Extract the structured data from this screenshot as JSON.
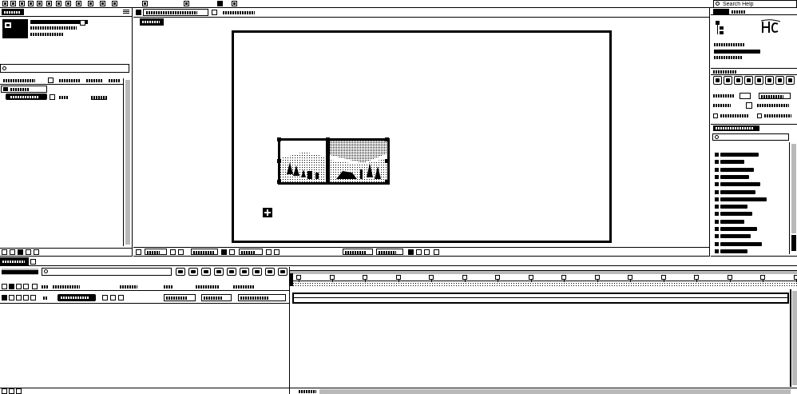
{
  "colors": {
    "ink": "#000000",
    "paper": "#ffffff"
  },
  "toolbar": {
    "tools": [
      "selection-tool-icon",
      "hand-tool-icon",
      "zoom-tool-icon",
      "rotation-tool-icon",
      "camera-tool-icon",
      "pan-behind-tool-icon",
      "rectangle-tool-icon",
      "pen-tool-icon",
      "type-tool-icon",
      "brush-tool-icon",
      "clone-stamp-tool-icon",
      "eraser-tool-icon",
      "roto-brush-tool-icon",
      "puppet-tool-icon",
      "fill-swatch-icon",
      "stroke-swatch-icon"
    ],
    "search_help": {
      "placeholder": "Search Help"
    }
  },
  "project_panel": {
    "footer_icons": [
      "interpret-footage-icon",
      "new-folder-icon",
      "new-composition-icon",
      "color-depth-icon",
      "delete-icon"
    ]
  },
  "preview_panel": {
    "buttons": [
      "first-frame-icon",
      "previous-frame-icon",
      "play-icon",
      "next-frame-icon",
      "last-frame-icon",
      "mute-icon",
      "loop-icon",
      "ram-preview-icon"
    ]
  },
  "effects_panel": {
    "item_icons": [
      "folder-icon",
      "folder-icon",
      "folder-icon",
      "folder-icon",
      "folder-icon",
      "folder-icon",
      "folder-icon",
      "folder-icon",
      "folder-icon",
      "folder-icon",
      "folder-icon",
      "folder-icon",
      "folder-icon",
      "folder-icon"
    ]
  },
  "timeline": {
    "buttons": [
      "mini-flowchart-icon",
      "draft-3d-icon",
      "shy-icon",
      "frame-blending-icon",
      "motion-blur-icon",
      "brainstorm-icon",
      "auto-keyframe-icon",
      "graph-editor-icon",
      "comp-flowchart-icon"
    ],
    "layer_switches": [
      "eye-icon",
      "audio-icon",
      "solo-icon",
      "lock-icon",
      "label-color-icon"
    ]
  }
}
